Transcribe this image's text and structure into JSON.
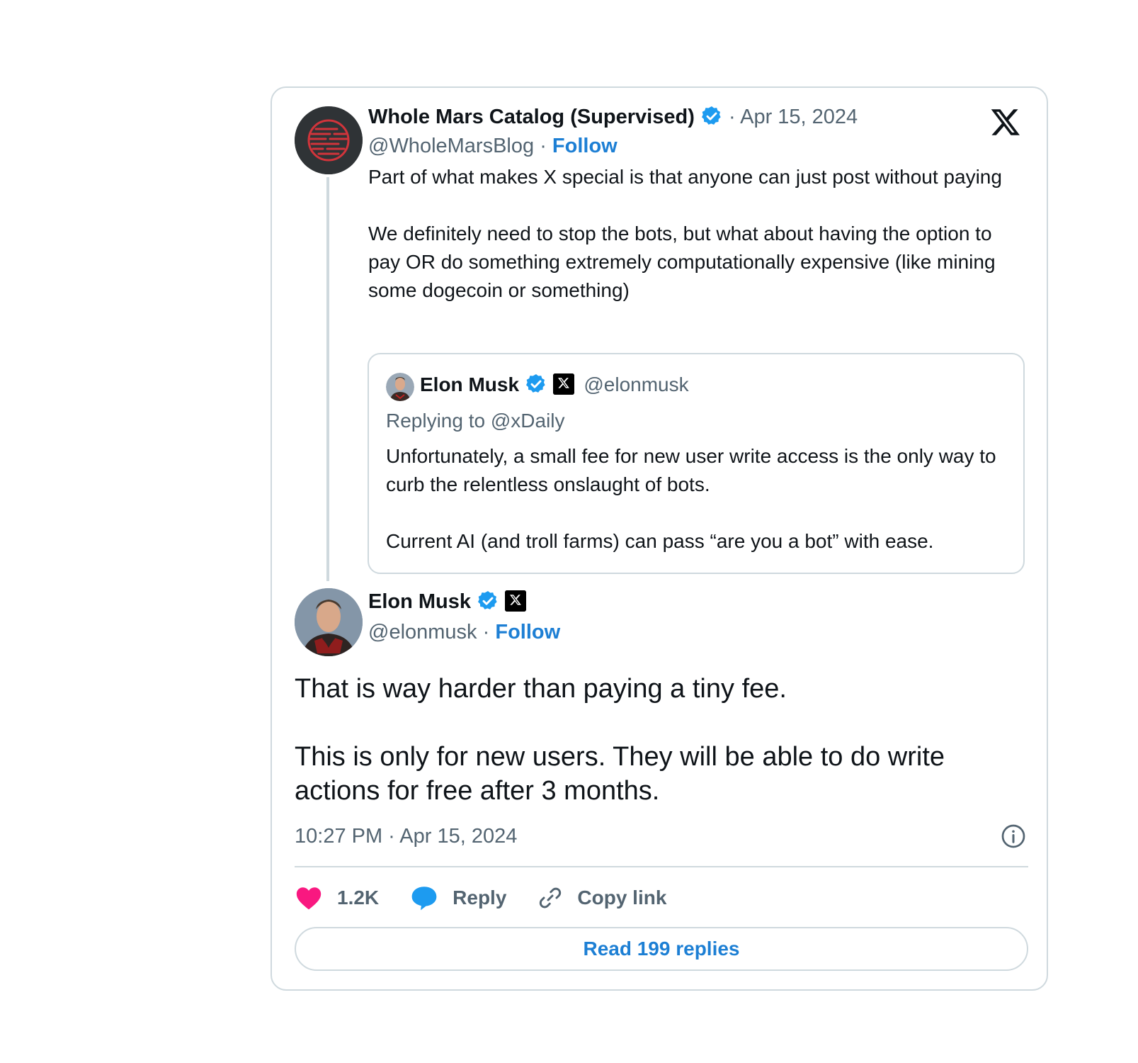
{
  "parent_tweet": {
    "author_name": "Whole Mars Catalog (Supervised)",
    "date": "· Apr 15, 2024",
    "handle": "@WholeMarsBlog",
    "separator": "·",
    "follow_label": "Follow",
    "text": "Part of what makes X special is that anyone can just post without paying\n\nWe definitely need to stop the bots, but what about having the option to pay OR do something extremely computationally expensive (like mining some dogecoin or something)"
  },
  "quoted_tweet": {
    "author_name": "Elon Musk",
    "handle": "@elonmusk",
    "replying_to": "Replying to @xDaily",
    "text": "Unfortunately, a small fee for new user write access is the only way to curb the relentless onslaught of bots.\n\nCurrent AI (and troll farms) can pass “are you a bot” with ease."
  },
  "main_tweet": {
    "author_name": "Elon Musk",
    "handle": "@elonmusk",
    "separator": "·",
    "follow_label": "Follow",
    "text": "That is way harder than paying a tiny fee.\n\nThis is only for new users. They will be able to do write actions for free after 3 months.",
    "timestamp": "10:27 PM · Apr 15, 2024"
  },
  "actions": {
    "like_count": "1.2K",
    "reply_label": "Reply",
    "copy_link_label": "Copy link"
  },
  "read_replies_label": "Read 199 replies",
  "colors": {
    "accent_blue": "#1d7fd4",
    "verified_blue": "#1d9bf0",
    "like_pink": "#f91880",
    "border": "#cfd9de",
    "muted_text": "#536471"
  },
  "icons": [
    "x-logo-icon",
    "verified-icon",
    "x-badge-icon",
    "info-icon",
    "heart-icon",
    "reply-bubble-icon",
    "link-icon"
  ]
}
